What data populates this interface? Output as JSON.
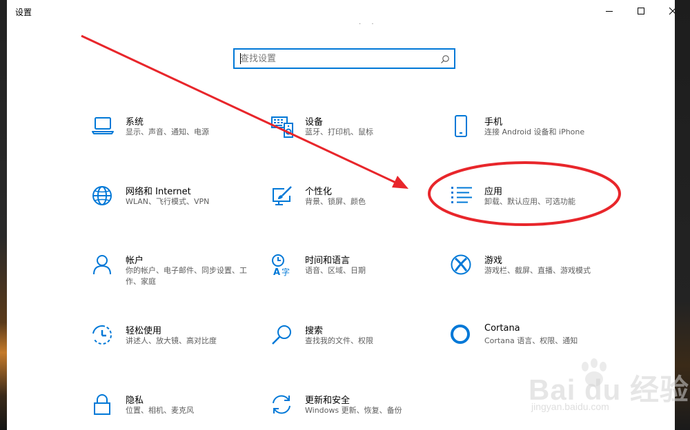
{
  "window": {
    "title": "设置"
  },
  "search": {
    "placeholder": "查找设置"
  },
  "colors": {
    "accent": "#0078d7",
    "annotation": "#e8262b"
  },
  "tiles": [
    {
      "title": "系统",
      "desc": "显示、声音、通知、电源",
      "icon": "laptop-icon"
    },
    {
      "title": "设备",
      "desc": "蓝牙、打印机、鼠标",
      "icon": "keyboard-devices-icon"
    },
    {
      "title": "手机",
      "desc": "连接 Android 设备和 iPhone",
      "icon": "phone-icon"
    },
    {
      "title": "网络和 Internet",
      "desc": "WLAN、飞行模式、VPN",
      "icon": "globe-icon"
    },
    {
      "title": "个性化",
      "desc": "背景、锁屏、颜色",
      "icon": "paint-brush-icon"
    },
    {
      "title": "应用",
      "desc": "卸载、默认应用、可选功能",
      "icon": "apps-list-icon"
    },
    {
      "title": "帐户",
      "desc": "你的帐户、电子邮件、同步设置、工作、家庭",
      "icon": "person-icon"
    },
    {
      "title": "时间和语言",
      "desc": "语音、区域、日期",
      "icon": "time-language-icon"
    },
    {
      "title": "游戏",
      "desc": "游戏栏、截屏、直播、游戏模式",
      "icon": "xbox-icon"
    },
    {
      "title": "轻松使用",
      "desc": "讲述人、放大镜、高对比度",
      "icon": "ease-of-access-icon"
    },
    {
      "title": "搜索",
      "desc": "查找我的文件、权限",
      "icon": "search-icon"
    },
    {
      "title": "Cortana",
      "desc": "Cortana 语言、权限、通知",
      "icon": "cortana-icon"
    },
    {
      "title": "隐私",
      "desc": "位置、相机、麦克风",
      "icon": "lock-icon"
    },
    {
      "title": "更新和安全",
      "desc": "Windows 更新、恢复、备份",
      "icon": "update-sync-icon"
    }
  ],
  "watermark": {
    "brand": "Bai du 经验",
    "url": "jingyan.baidu.com"
  }
}
